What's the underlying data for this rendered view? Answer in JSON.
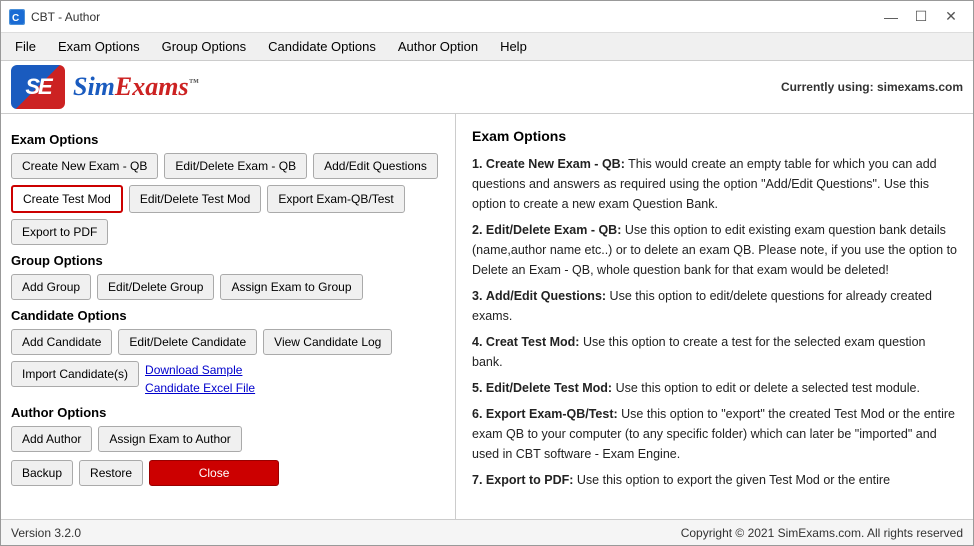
{
  "window": {
    "title": "CBT - Author",
    "icon_label": "SE"
  },
  "title_controls": {
    "minimize": "—",
    "maximize": "☐",
    "close": "✕"
  },
  "menu": {
    "items": [
      "File",
      "Exam Options",
      "Group Options",
      "Candidate Options",
      "Author Option",
      "Help"
    ]
  },
  "status_top": {
    "label": "Currently using: simexams.com"
  },
  "logo": {
    "text": "SimExams",
    "tm": "™"
  },
  "left_panel": {
    "exam_options_header": "Exam Options",
    "exam_buttons_row1": [
      "Create New Exam - QB",
      "Edit/Delete Exam - QB",
      "Add/Edit Questions"
    ],
    "exam_buttons_row2_btn1": "Create Test Mod",
    "exam_buttons_row2_btn2": "Edit/Delete Test Mod",
    "exam_buttons_row2_btn3": "Export Exam-QB/Test",
    "exam_buttons_row3": [
      "Export to PDF"
    ],
    "group_options_header": "Group Options",
    "group_buttons": [
      "Add Group",
      "Edit/Delete Group",
      "Assign Exam to Group"
    ],
    "candidate_options_header": "Candidate Options",
    "candidate_buttons_row1": [
      "Add Candidate",
      "Edit/Delete Candidate",
      "View Candidate Log"
    ],
    "import_candidate_btn": "Import Candidate(s)",
    "download_sample_link": "Download Sample",
    "candidate_excel_link": "Candidate Excel File",
    "author_options_header": "Author Options",
    "author_buttons": [
      "Add Author",
      "Assign Exam to Author"
    ],
    "bottom_buttons": {
      "backup": "Backup",
      "restore": "Restore",
      "close": "Close"
    }
  },
  "right_panel": {
    "title": "Exam Options",
    "content": [
      {
        "num": "1.",
        "label": "Create New Exam - QB:",
        "text": " This would create an empty table for which you can add questions and answers as required using the option \"Add/Edit Questions\". Use this option to create a new exam Question Bank."
      },
      {
        "num": "2.",
        "label": "Edit/Delete Exam - QB:",
        "text": " Use this option to edit existing exam question bank details (name,author name etc..) or to delete an exam QB. Please note, if you use the option to Delete an Exam - QB, whole question bank for that exam would be deleted!"
      },
      {
        "num": "3.",
        "label": "Add/Edit Questions:",
        "text": " Use this option to edit/delete questions for already created exams."
      },
      {
        "num": "4.",
        "label": "Creat Test Mod:",
        "text": " Use this option to create a test for the selected exam question bank."
      },
      {
        "num": "5.",
        "label": "Edit/Delete Test Mod:",
        "text": " Use this option to edit or delete a selected test module."
      },
      {
        "num": "6.",
        "label": "Export Exam-QB/Test:",
        "text": " Use this option to \"export\" the created Test Mod or the entire exam QB to your computer (to any specific folder) which can later be \"imported\" and used in CBT software - Exam Engine."
      },
      {
        "num": "7.",
        "label": "Export to PDF:",
        "text": " Use this option to export the given Test Mod or the entire"
      }
    ]
  },
  "status_bottom": {
    "version": "Version 3.2.0",
    "copyright": "Copyright © 2021 SimExams.com. All rights reserved"
  }
}
